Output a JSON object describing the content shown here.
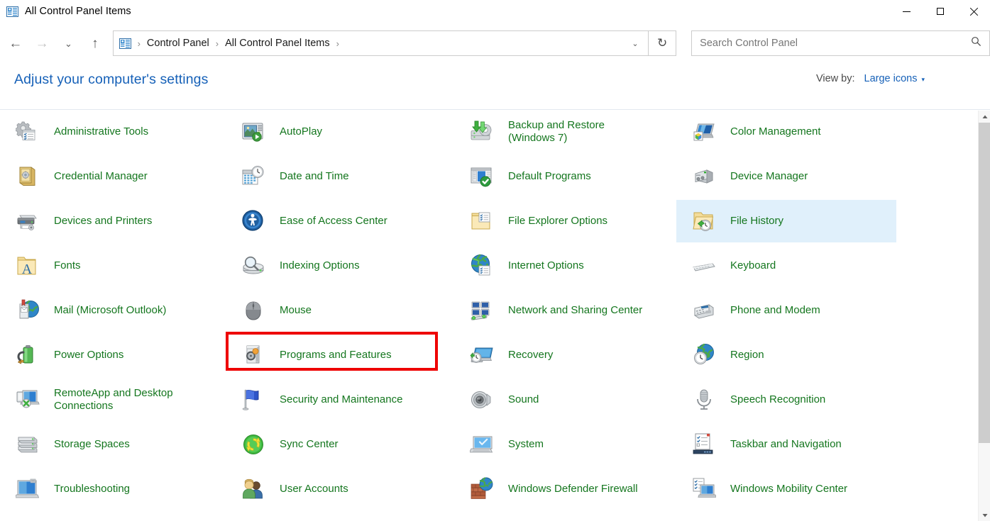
{
  "window": {
    "title": "All Control Panel Items",
    "title_icon": "control-panel-icon",
    "minimize_label": "Minimize",
    "maximize_label": "Maximize",
    "close_label": "Close"
  },
  "navbar": {
    "back_icon": "←",
    "forward_icon": "→",
    "recent_icon": "⌄",
    "up_icon": "↑",
    "breadcrumbs": [
      "Control Panel",
      "All Control Panel Items"
    ],
    "separator": "›",
    "dropdown_icon": "⌄",
    "refresh_icon": "↻"
  },
  "search": {
    "placeholder": "Search Control Panel",
    "value": "",
    "icon": "⌕"
  },
  "header": {
    "page_title": "Adjust your computer's settings",
    "view_by_label": "View by:",
    "view_by_value": "Large icons",
    "view_by_caret": "▾"
  },
  "colors": {
    "link_blue": "#1661b8",
    "item_green": "#14761e",
    "highlight_red": "#ee0000",
    "selection_blue": "#e0f0fb"
  },
  "items": [
    {
      "label": "Administrative Tools",
      "icon": "administrative-tools-icon",
      "col": 0,
      "row": 0
    },
    {
      "label": "AutoPlay",
      "icon": "autoplay-icon",
      "col": 1,
      "row": 0
    },
    {
      "label": "Backup and Restore (Windows 7)",
      "icon": "backup-restore-icon",
      "col": 2,
      "row": 0
    },
    {
      "label": "Color Management",
      "icon": "color-management-icon",
      "col": 3,
      "row": 0
    },
    {
      "label": "Credential Manager",
      "icon": "credential-manager-icon",
      "col": 0,
      "row": 1
    },
    {
      "label": "Date and Time",
      "icon": "date-time-icon",
      "col": 1,
      "row": 1
    },
    {
      "label": "Default Programs",
      "icon": "default-programs-icon",
      "col": 2,
      "row": 1
    },
    {
      "label": "Device Manager",
      "icon": "device-manager-icon",
      "col": 3,
      "row": 1
    },
    {
      "label": "Devices and Printers",
      "icon": "devices-printers-icon",
      "col": 0,
      "row": 2
    },
    {
      "label": "Ease of Access Center",
      "icon": "ease-of-access-icon",
      "col": 1,
      "row": 2
    },
    {
      "label": "File Explorer Options",
      "icon": "file-explorer-options-icon",
      "col": 2,
      "row": 2
    },
    {
      "label": "File History",
      "icon": "file-history-icon",
      "col": 3,
      "row": 2,
      "selected": true
    },
    {
      "label": "Fonts",
      "icon": "fonts-icon",
      "col": 0,
      "row": 3
    },
    {
      "label": "Indexing Options",
      "icon": "indexing-options-icon",
      "col": 1,
      "row": 3
    },
    {
      "label": "Internet Options",
      "icon": "internet-options-icon",
      "col": 2,
      "row": 3
    },
    {
      "label": "Keyboard",
      "icon": "keyboard-icon",
      "col": 3,
      "row": 3
    },
    {
      "label": "Mail (Microsoft Outlook)",
      "icon": "mail-icon",
      "col": 0,
      "row": 4
    },
    {
      "label": "Mouse",
      "icon": "mouse-icon",
      "col": 1,
      "row": 4
    },
    {
      "label": "Network and Sharing Center",
      "icon": "network-sharing-icon",
      "col": 2,
      "row": 4
    },
    {
      "label": "Phone and Modem",
      "icon": "phone-modem-icon",
      "col": 3,
      "row": 4
    },
    {
      "label": "Power Options",
      "icon": "power-options-icon",
      "col": 0,
      "row": 5
    },
    {
      "label": "Programs and Features",
      "icon": "programs-features-icon",
      "col": 1,
      "row": 5,
      "highlighted": true
    },
    {
      "label": "Recovery",
      "icon": "recovery-icon",
      "col": 2,
      "row": 5
    },
    {
      "label": "Region",
      "icon": "region-icon",
      "col": 3,
      "row": 5
    },
    {
      "label": "RemoteApp and Desktop Connections",
      "icon": "remoteapp-icon",
      "col": 0,
      "row": 6
    },
    {
      "label": "Security and Maintenance",
      "icon": "security-maintenance-icon",
      "col": 1,
      "row": 6
    },
    {
      "label": "Sound",
      "icon": "sound-icon",
      "col": 2,
      "row": 6
    },
    {
      "label": "Speech Recognition",
      "icon": "speech-recognition-icon",
      "col": 3,
      "row": 6
    },
    {
      "label": "Storage Spaces",
      "icon": "storage-spaces-icon",
      "col": 0,
      "row": 7
    },
    {
      "label": "Sync Center",
      "icon": "sync-center-icon",
      "col": 1,
      "row": 7
    },
    {
      "label": "System",
      "icon": "system-icon",
      "col": 2,
      "row": 7
    },
    {
      "label": "Taskbar and Navigation",
      "icon": "taskbar-navigation-icon",
      "col": 3,
      "row": 7
    },
    {
      "label": "Troubleshooting",
      "icon": "troubleshooting-icon",
      "col": 0,
      "row": 8
    },
    {
      "label": "User Accounts",
      "icon": "user-accounts-icon",
      "col": 1,
      "row": 8
    },
    {
      "label": "Windows Defender Firewall",
      "icon": "windows-defender-firewall-icon",
      "col": 2,
      "row": 8
    },
    {
      "label": "Windows Mobility Center",
      "icon": "windows-mobility-icon",
      "col": 3,
      "row": 8
    }
  ],
  "scrollbar": {
    "up_arrow": "▲",
    "down_arrow": "▼"
  }
}
